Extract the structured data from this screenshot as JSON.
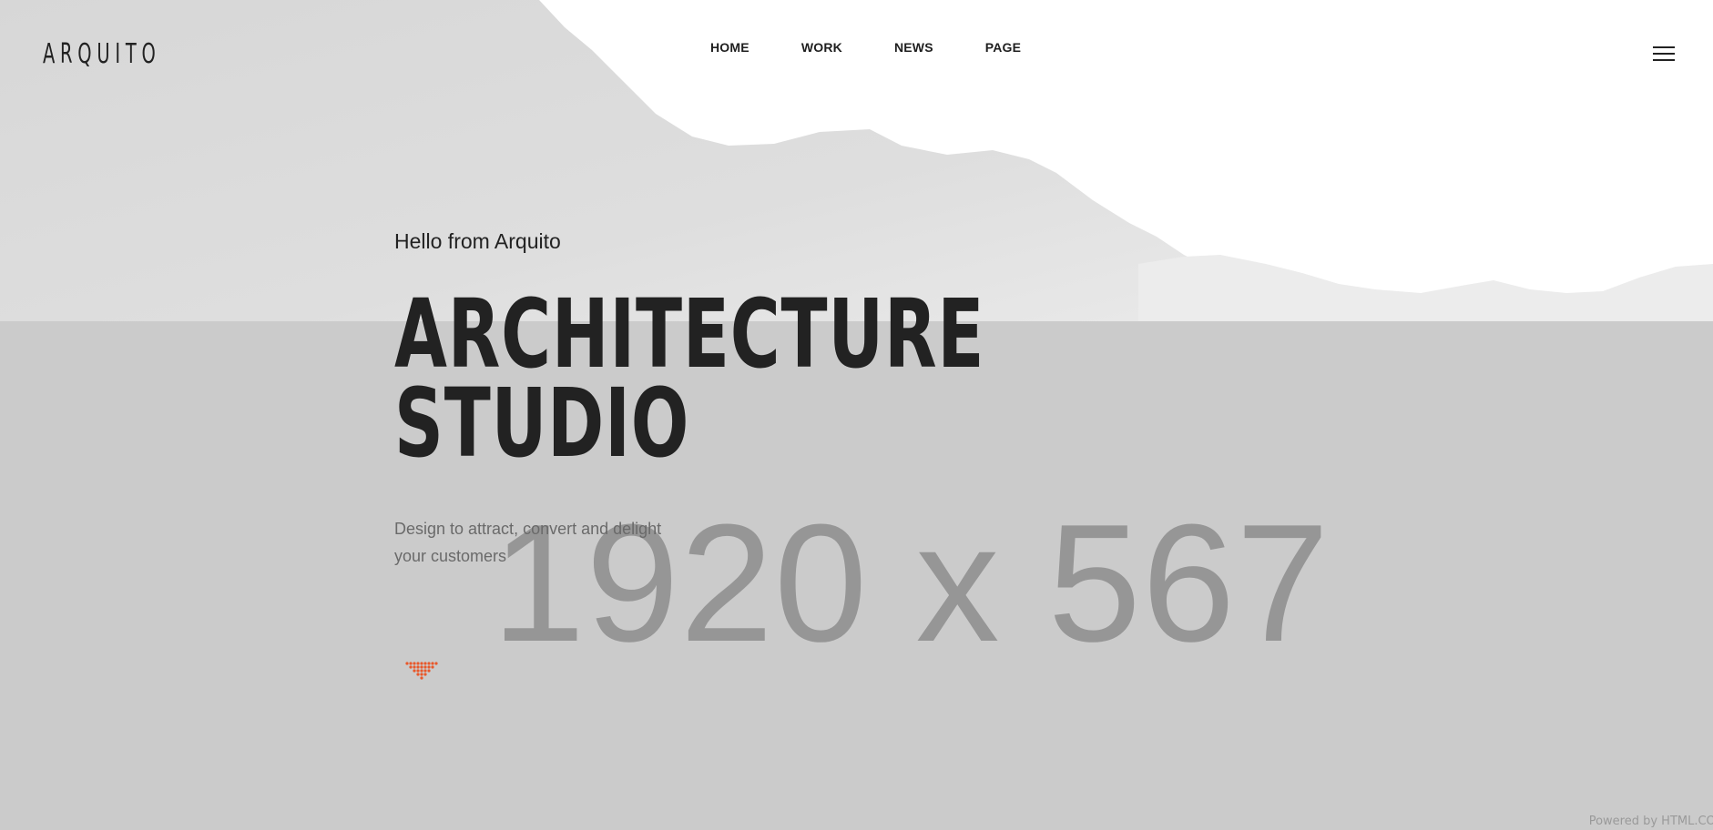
{
  "header": {
    "logo": "ARQUITO",
    "nav": [
      {
        "label": "HOME"
      },
      {
        "label": "WORK"
      },
      {
        "label": "NEWS"
      },
      {
        "label": "PAGE"
      }
    ],
    "menu_icon": "hamburger-menu-icon"
  },
  "hero": {
    "kicker": "Hello from Arquito",
    "title_line1": "ARCHITECTURE",
    "title_line2": "STUDIO",
    "subtitle": "Design to attract, convert and delight your customers",
    "scroll_icon": "dotted-down-arrow-icon"
  },
  "placeholder": {
    "text": "1920 x 567"
  },
  "footer": {
    "powered_by": "Powered by HTML.COM"
  },
  "colors": {
    "background": "#ffffff",
    "placeholder": "#cbcbcb",
    "placeholder_text": "#969696",
    "heading": "#222222",
    "accent": "#e8582b"
  }
}
